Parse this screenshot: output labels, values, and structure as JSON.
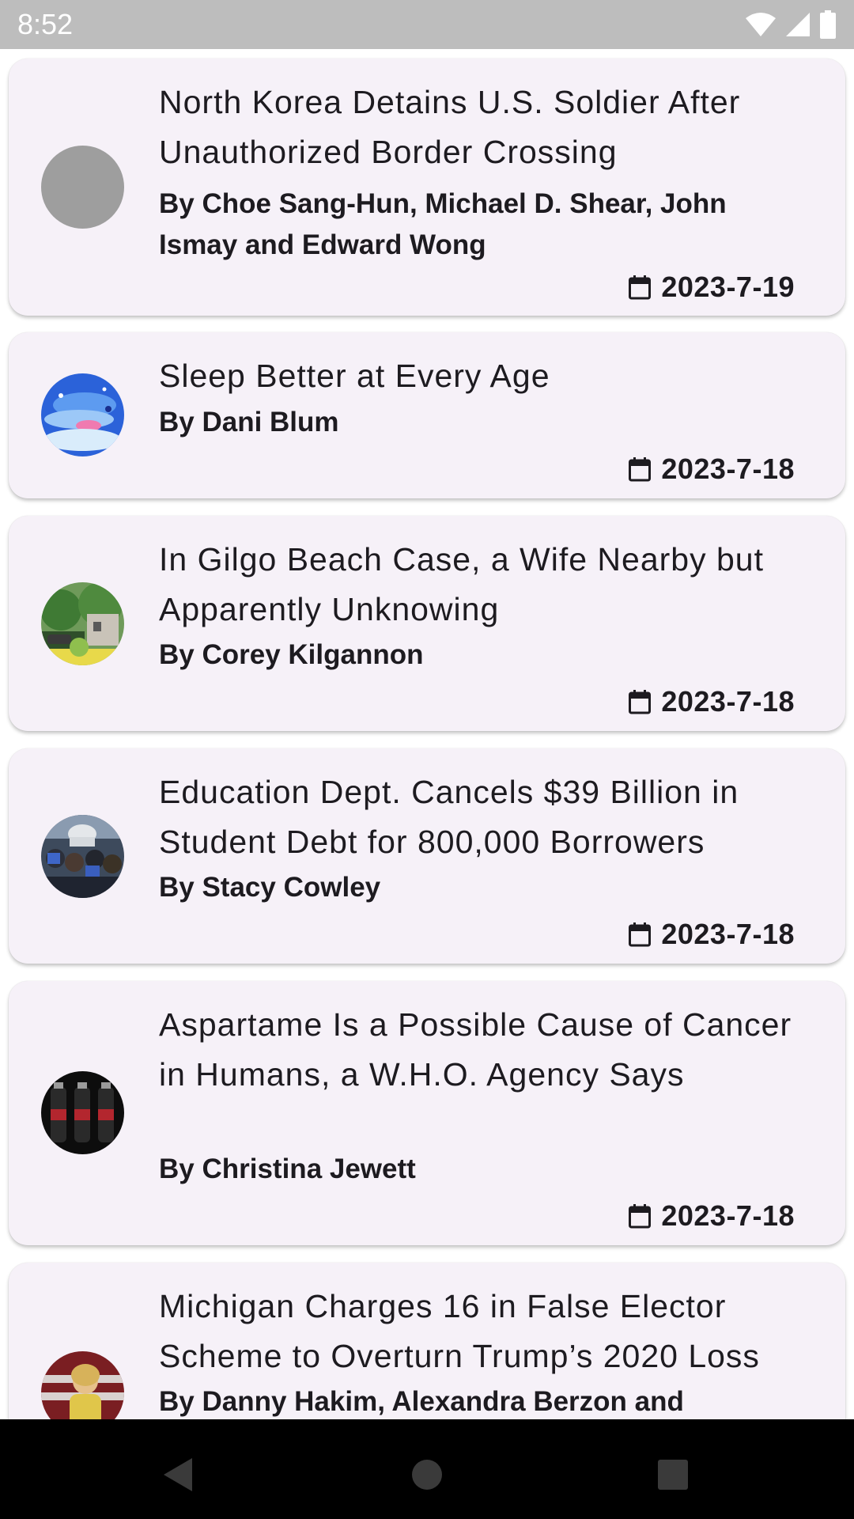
{
  "status_bar": {
    "time": "8:52",
    "icons": [
      "wifi-icon",
      "signal-icon",
      "battery-icon"
    ]
  },
  "articles": [
    {
      "title": "North Korea Detains U.S. Soldier After Unauthorized Border Crossing",
      "author": "By Choe Sang-Hun, Michael D. Shear, John Ismay and Edward Wong",
      "date": "2023-7-19",
      "thumbnail": "placeholder-gray"
    },
    {
      "title": "Sleep Better at Every Age",
      "author": "By Dani Blum",
      "date": "2023-7-18",
      "thumbnail": "blue-illustration"
    },
    {
      "title": "In Gilgo Beach Case, a Wife Nearby but Apparently Unknowing",
      "author": "By Corey Kilgannon",
      "date": "2023-7-18",
      "thumbnail": "house-and-trees"
    },
    {
      "title": "Education Dept. Cancels $39 Billion in Student Debt for 800,000 Borrowers",
      "author": "By Stacy Cowley",
      "date": "2023-7-18",
      "thumbnail": "capitol-protest"
    },
    {
      "title": "Aspartame Is a Possible Cause of Cancer in Humans, a W.H.O. Agency Says",
      "author": "By Christina Jewett",
      "date": "2023-7-18",
      "thumbnail": "soda-bottles"
    },
    {
      "title": "Michigan Charges 16 in False Elector Scheme to Overturn Trump’s 2020 Loss",
      "author": "By Danny Hakim, Alexandra Berzon and",
      "date": "",
      "thumbnail": "person-portrait"
    }
  ],
  "nav_bar": {
    "buttons": [
      "back-icon",
      "home-icon",
      "recents-icon"
    ]
  },
  "colors": {
    "card_background": "#f6f1f8",
    "status_bar": "#bdbdbd",
    "nav_bar": "#000000",
    "text": "#1d1b20"
  }
}
